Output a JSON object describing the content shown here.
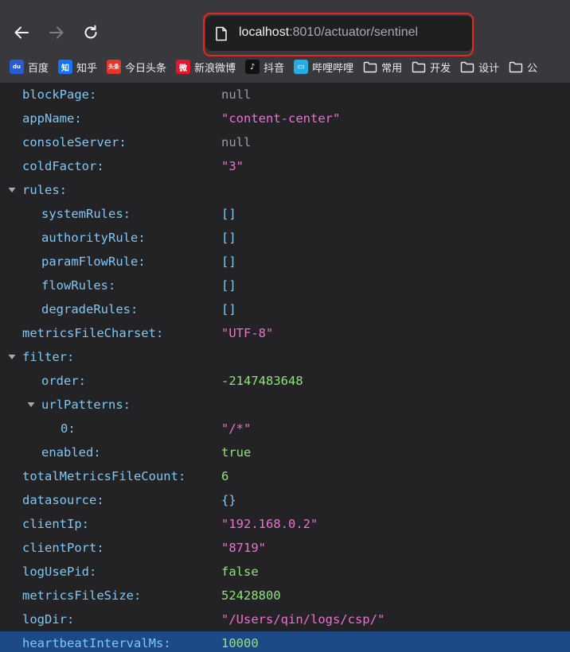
{
  "browser": {
    "url_host": "localhost",
    "url_rest": ":8010/actuator/sentinel",
    "bookmarks": [
      {
        "label": "百度",
        "icon": "baidu-icon",
        "color": "#2a5bd7",
        "glyph": "du"
      },
      {
        "label": "知乎",
        "icon": "zhihu-icon",
        "color": "#1772f6",
        "glyph": "知"
      },
      {
        "label": "今日头条",
        "icon": "toutiao-icon",
        "color": "#e8352b",
        "glyph": "头条"
      },
      {
        "label": "新浪微博",
        "icon": "weibo-icon",
        "color": "#e6162d",
        "glyph": "微"
      },
      {
        "label": "抖音",
        "icon": "douyin-icon",
        "color": "#111111",
        "glyph": "♪"
      },
      {
        "label": "哔哩哔哩",
        "icon": "bilibili-icon",
        "color": "#23ade5",
        "glyph": "▭"
      },
      {
        "label": "常用",
        "icon": "folder-icon"
      },
      {
        "label": "开发",
        "icon": "folder-icon"
      },
      {
        "label": "设计",
        "icon": "folder-icon"
      },
      {
        "label": "公",
        "icon": "folder-icon"
      }
    ]
  },
  "json_rows": [
    {
      "key": "blockPage:",
      "value": "null",
      "type": "null",
      "indent": 0,
      "toggle": false
    },
    {
      "key": "appName:",
      "value": "\"content-center\"",
      "type": "str",
      "indent": 0,
      "toggle": false
    },
    {
      "key": "consoleServer:",
      "value": "null",
      "type": "null",
      "indent": 0,
      "toggle": false
    },
    {
      "key": "coldFactor:",
      "value": "\"3\"",
      "type": "str",
      "indent": 0,
      "toggle": false
    },
    {
      "key": "rules:",
      "value": "",
      "type": "obj",
      "indent": 0,
      "toggle": true
    },
    {
      "key": "systemRules:",
      "value": "[]",
      "type": "obj",
      "indent": 1,
      "toggle": false
    },
    {
      "key": "authorityRule:",
      "value": "[]",
      "type": "obj",
      "indent": 1,
      "toggle": false
    },
    {
      "key": "paramFlowRule:",
      "value": "[]",
      "type": "obj",
      "indent": 1,
      "toggle": false
    },
    {
      "key": "flowRules:",
      "value": "[]",
      "type": "obj",
      "indent": 1,
      "toggle": false
    },
    {
      "key": "degradeRules:",
      "value": "[]",
      "type": "obj",
      "indent": 1,
      "toggle": false
    },
    {
      "key": "metricsFileCharset:",
      "value": "\"UTF-8\"",
      "type": "str",
      "indent": 0,
      "toggle": false
    },
    {
      "key": "filter:",
      "value": "",
      "type": "obj",
      "indent": 0,
      "toggle": true
    },
    {
      "key": "order:",
      "value": "-2147483648",
      "type": "num",
      "indent": 1,
      "toggle": false
    },
    {
      "key": "urlPatterns:",
      "value": "",
      "type": "obj",
      "indent": 1,
      "toggle": true
    },
    {
      "key": "0:",
      "value": "\"/*\"",
      "type": "str",
      "indent": 2,
      "toggle": false
    },
    {
      "key": "enabled:",
      "value": "true",
      "type": "bool",
      "indent": 1,
      "toggle": false
    },
    {
      "key": "totalMetricsFileCount:",
      "value": "6",
      "type": "num",
      "indent": 0,
      "toggle": false
    },
    {
      "key": "datasource:",
      "value": "{}",
      "type": "obj",
      "indent": 0,
      "toggle": false
    },
    {
      "key": "clientIp:",
      "value": "\"192.168.0.2\"",
      "type": "str",
      "indent": 0,
      "toggle": false
    },
    {
      "key": "clientPort:",
      "value": "\"8719\"",
      "type": "str",
      "indent": 0,
      "toggle": false
    },
    {
      "key": "logUsePid:",
      "value": "false",
      "type": "bool",
      "indent": 0,
      "toggle": false
    },
    {
      "key": "metricsFileSize:",
      "value": "52428800",
      "type": "num",
      "indent": 0,
      "toggle": false
    },
    {
      "key": "logDir:",
      "value": "\"/Users/qin/logs/csp/\"",
      "type": "str",
      "indent": 0,
      "toggle": false
    },
    {
      "key": "heartbeatIntervalMs:",
      "value": "10000",
      "type": "num",
      "indent": 0,
      "toggle": false,
      "selected": true
    }
  ]
}
